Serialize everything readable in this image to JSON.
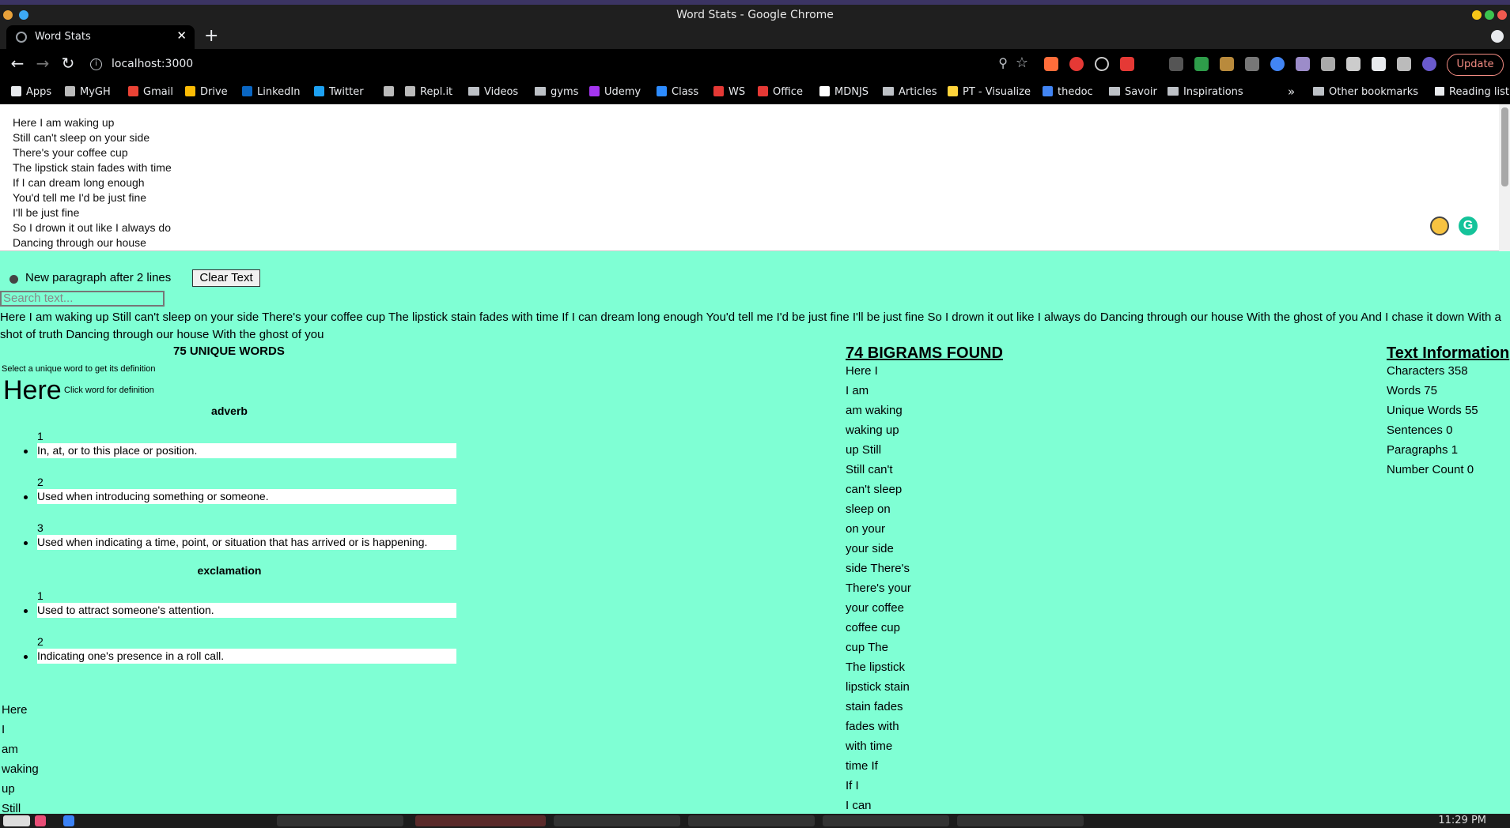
{
  "window": {
    "title": "Word Stats - Google Chrome"
  },
  "tab": {
    "title": "Word Stats"
  },
  "address": {
    "url": "localhost:3000",
    "update_label": "Update"
  },
  "bookmarks": [
    {
      "label": "Apps",
      "icon": "apps-grid-icon"
    },
    {
      "label": "MyGH",
      "icon": "github-icon"
    },
    {
      "label": "Gmail",
      "icon": "gmail-icon"
    },
    {
      "label": "Drive",
      "icon": "drive-icon"
    },
    {
      "label": "LinkedIn",
      "icon": "linkedin-icon"
    },
    {
      "label": "Twitter",
      "icon": "twitter-icon"
    },
    {
      "label": "",
      "icon": "github-icon"
    },
    {
      "label": "Repl.it",
      "icon": "replit-icon"
    },
    {
      "label": "Videos",
      "icon": "folder-icon"
    },
    {
      "label": "gyms",
      "icon": "folder-icon"
    },
    {
      "label": "Udemy",
      "icon": "udemy-icon"
    },
    {
      "label": "Class",
      "icon": "zoom-icon"
    },
    {
      "label": "WS",
      "icon": "ws-icon"
    },
    {
      "label": "Office",
      "icon": "office-icon"
    },
    {
      "label": "MDNJS",
      "icon": "mdn-icon"
    },
    {
      "label": "Articles",
      "icon": "folder-icon"
    },
    {
      "label": "PT - Visualize",
      "icon": "python-icon"
    },
    {
      "label": "thedoc",
      "icon": "docs-icon"
    },
    {
      "label": "Savoir",
      "icon": "folder-icon"
    },
    {
      "label": "Inspirations",
      "icon": "folder-icon"
    }
  ],
  "bookmarks_right": {
    "more": "»",
    "other": "Other bookmarks",
    "reading": "Reading list"
  },
  "editor": {
    "lines": [
      "Here I am waking up",
      "Still can't sleep on your side",
      "There's your coffee cup",
      "The lipstick stain fades with time",
      "If I can dream long enough",
      "You'd tell me I'd be just fine",
      "I'll be just fine",
      "So I drown it out like I always do",
      "Dancing through our house"
    ]
  },
  "controls": {
    "toggle_label": "New paragraph after 2 lines",
    "clear_label": "Clear Text",
    "search_placeholder": "Search text..."
  },
  "paragraph": "Here I am waking up Still can't sleep on your side There's your coffee cup The lipstick stain fades with time If I can dream long enough You'd tell me I'd be just fine I'll be just fine So I drown it out like I always do Dancing through our house With the ghost of you And I chase it down With a shot of truth Dancing through our house With the ghost of you",
  "unique": {
    "title": "75 UNIQUE WORDS",
    "select_hint": "Select a unique word to get its definition",
    "selected_word": "Here",
    "click_hint": "Click word for definition",
    "groups": [
      {
        "pos": "adverb",
        "definitions": [
          {
            "num": "1",
            "text": "In, at, or to this place or position."
          },
          {
            "num": "2",
            "text": "Used when introducing something or someone."
          },
          {
            "num": "3",
            "text": "Used when indicating a time, point, or situation that has arrived or is happening."
          }
        ]
      },
      {
        "pos": "exclamation",
        "definitions": [
          {
            "num": "1",
            "text": "Used to attract someone's attention."
          },
          {
            "num": "2",
            "text": "Indicating one's presence in a roll call."
          }
        ]
      }
    ],
    "words": [
      "Here",
      "I",
      "am",
      "waking",
      "up",
      "Still"
    ]
  },
  "bigrams": {
    "title": "74 BIGRAMS FOUND",
    "items": [
      "Here I",
      "I am",
      "am waking",
      "waking up",
      "up Still",
      "Still can't",
      "can't sleep",
      "sleep on",
      "on your",
      "your side",
      "side There's",
      "There's your",
      "your coffee",
      "coffee cup",
      "cup The",
      "The lipstick",
      "lipstick stain",
      "stain fades",
      "fades with",
      "with time",
      "time If",
      "If I",
      "I can"
    ]
  },
  "info": {
    "title": "Text Information",
    "rows": [
      {
        "label": "Characters",
        "value": "358"
      },
      {
        "label": "Words",
        "value": "75"
      },
      {
        "label": "Unique Words",
        "value": "55"
      },
      {
        "label": "Sentences",
        "value": "0"
      },
      {
        "label": "Paragraphs",
        "value": "1"
      },
      {
        "label": "Number Count",
        "value": "0"
      }
    ]
  },
  "taskbar": {
    "time": "11:29 PM"
  }
}
